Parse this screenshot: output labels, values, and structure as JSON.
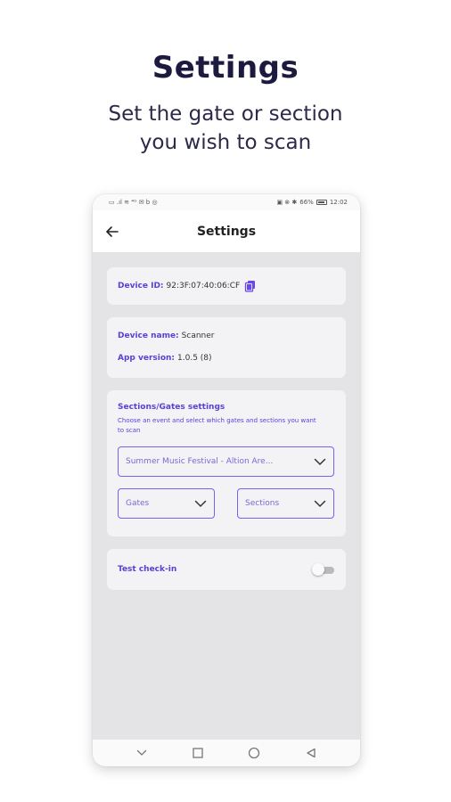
{
  "promo": {
    "title": "Settings",
    "subtitle_line1": "Set the gate or section",
    "subtitle_line2": "you wish to scan"
  },
  "statusbar": {
    "left_glyphs": "▭ .ıl ≋ ⁴ᴳ ✉ b ◎",
    "battery_percent": "66%",
    "time": "12:02"
  },
  "appbar": {
    "back_icon": "arrow-left-icon",
    "title": "Settings"
  },
  "device": {
    "id_label": "Device ID:",
    "id_value": "92:3F:07:40:06:CF",
    "copy_icon": "copy-icon"
  },
  "info": {
    "name_label": "Device name:",
    "name_value": "Scanner",
    "version_label": "App version:",
    "version_value": "1.0.5 (8)"
  },
  "sections": {
    "title": "Sections/Gates settings",
    "description": "Choose an event and select which gates and sections you want to scan",
    "event_select": "Summer Music Festival  - Altion Are...",
    "gates_select": "Gates",
    "sections_select": "Sections"
  },
  "test_checkin": {
    "label": "Test check-in",
    "enabled": false
  },
  "navbar": {
    "icons": [
      "chevron-down-icon",
      "square-icon",
      "circle-icon",
      "triangle-back-icon"
    ]
  },
  "colors": {
    "accent": "#5a3fd6",
    "select_border": "#7c5ef0",
    "screen_bg": "#e4e4e7",
    "card_bg": "#f3f3f6"
  }
}
